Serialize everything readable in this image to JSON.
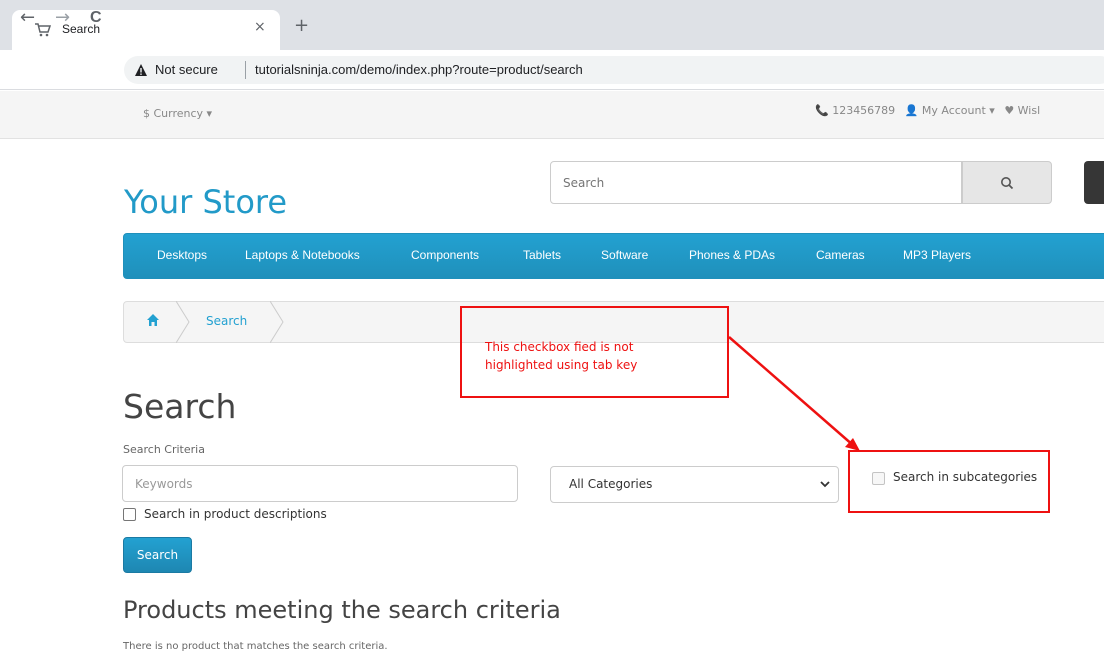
{
  "browser": {
    "tab_title": "Search",
    "tab_close": "×",
    "new_tab": "+",
    "back": "←",
    "forward": "→",
    "reload": "C",
    "security_label": "Not secure",
    "url": "tutorialsninja.com/demo/index.php?route=product/search"
  },
  "topbar": {
    "currency": "$ Currency ▾",
    "phone": "📞 123456789",
    "account": "👤 My Account ▾",
    "wishlist": "♥ Wisl"
  },
  "header": {
    "logo": "Your Store",
    "search_placeholder": "Search"
  },
  "menu": [
    {
      "label": "Desktops"
    },
    {
      "label": "Laptops & Notebooks"
    },
    {
      "label": "Components"
    },
    {
      "label": "Tablets"
    },
    {
      "label": "Software"
    },
    {
      "label": "Phones & PDAs"
    },
    {
      "label": "Cameras"
    },
    {
      "label": "MP3 Players"
    }
  ],
  "breadcrumb": {
    "current": "Search"
  },
  "content": {
    "title": "Search",
    "criteria_label": "Search Criteria",
    "keywords_placeholder": "Keywords",
    "category_selected": "All Categories",
    "subcategories_label": "Search in subcategories",
    "descriptions_label": "Search in product descriptions",
    "search_button": "Search",
    "products_title": "Products meeting the search criteria",
    "no_results": "There is no product that matches the search criteria."
  },
  "annotation": {
    "text_line1": "This checkbox fied is not",
    "text_line2": "highlighted using tab key",
    "color": "#ee1111"
  },
  "colors": {
    "brand_blue": "#229ac8",
    "menu_blue": "#23a1d1"
  }
}
